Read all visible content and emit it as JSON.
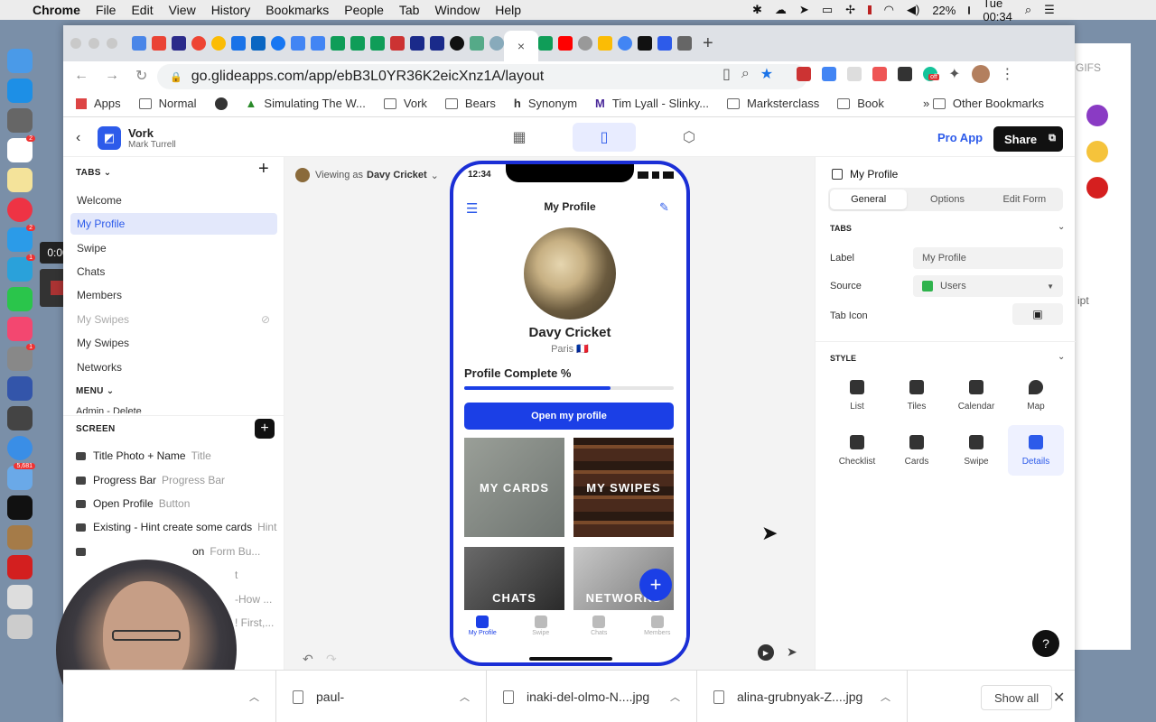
{
  "menubar": {
    "items": [
      "Chrome",
      "File",
      "Edit",
      "View",
      "History",
      "Bookmarks",
      "People",
      "Tab",
      "Window",
      "Help"
    ],
    "battery": "22%",
    "clock": "Tue 00:34"
  },
  "dock": {
    "timer": "0:00",
    "badges": {
      "calendar": "2",
      "messages": "2",
      "telegram": "1",
      "settings": "1",
      "mail": "5,681"
    }
  },
  "browser": {
    "url": "go.glideapps.com/app/ebB3L0YR36K2eicXnz1A/layout",
    "active_tab_close": "×",
    "new_tab": "+",
    "ext_badge": "off",
    "bookmarks": [
      "Apps",
      "Normal",
      "Simulating The W...",
      "Vork",
      "Bears",
      "Synonym",
      "Tim Lyall - Slinky...",
      "Marksterclass",
      "Book"
    ],
    "bookmarks_more": "»",
    "other_bookmarks": "Other Bookmarks"
  },
  "background_window": {
    "gifs": "GIFS",
    "partial": "ipt"
  },
  "app": {
    "name": "Vork",
    "owner": "Mark Turrell",
    "pro_app": "Pro App",
    "share": "Share"
  },
  "left_panel": {
    "tabs_header": "TABS",
    "tabs": [
      {
        "label": "Welcome"
      },
      {
        "label": "My Profile"
      },
      {
        "label": "Swipe"
      },
      {
        "label": "Chats"
      },
      {
        "label": "Members"
      },
      {
        "label": "My Swipes"
      },
      {
        "label": "My Swipes"
      },
      {
        "label": "Networks"
      }
    ],
    "menu_header": "MENU",
    "menu_partial": "Admin - Delete",
    "screen_header": "SCREEN",
    "components": [
      {
        "name": "Title Photo + Name",
        "type": "Title"
      },
      {
        "name": "Progress Bar",
        "type": "Progress Bar"
      },
      {
        "name": "Open Profile",
        "type": "Button"
      },
      {
        "name": "Existing - Hint create some cards",
        "type": "Hint"
      },
      {
        "name": "on",
        "type": "Form Bu..."
      },
      {
        "name": "",
        "type": "t"
      },
      {
        "name": "",
        "type": "-How ..."
      },
      {
        "name": "",
        "type": "! First,..."
      }
    ]
  },
  "canvas": {
    "viewing_as_label": "Viewing as",
    "viewing_as_user": "Davy Cricket",
    "phone": {
      "status_time": "12:34",
      "header": "My Profile",
      "name": "Davy Cricket",
      "location": "Paris 🇫🇷",
      "progress_title": "Profile Complete %",
      "progress_value": 0.7,
      "open_button": "Open my profile",
      "tiles": [
        "MY CARDS",
        "MY SWIPES",
        "CHATS",
        "NETWORKS"
      ],
      "fab": "+",
      "tabbar": [
        "My Profile",
        "Swipe",
        "Chats",
        "Members"
      ]
    }
  },
  "right_panel": {
    "title": "My Profile",
    "segments": [
      "General",
      "Options",
      "Edit Form"
    ],
    "tabs_section": "TABS",
    "label_label": "Label",
    "label_value": "My Profile",
    "source_label": "Source",
    "source_value": "Users",
    "tab_icon_label": "Tab Icon",
    "style_section": "STYLE",
    "styles": [
      "List",
      "Tiles",
      "Calendar",
      "Map",
      "Checklist",
      "Cards",
      "Swipe",
      "Details"
    ],
    "help": "?"
  },
  "downloads": {
    "items": [
      "paul-",
      "inaki-del-olmo-N....jpg",
      "alina-grubnyak-Z....jpg"
    ],
    "show_all": "Show all"
  }
}
